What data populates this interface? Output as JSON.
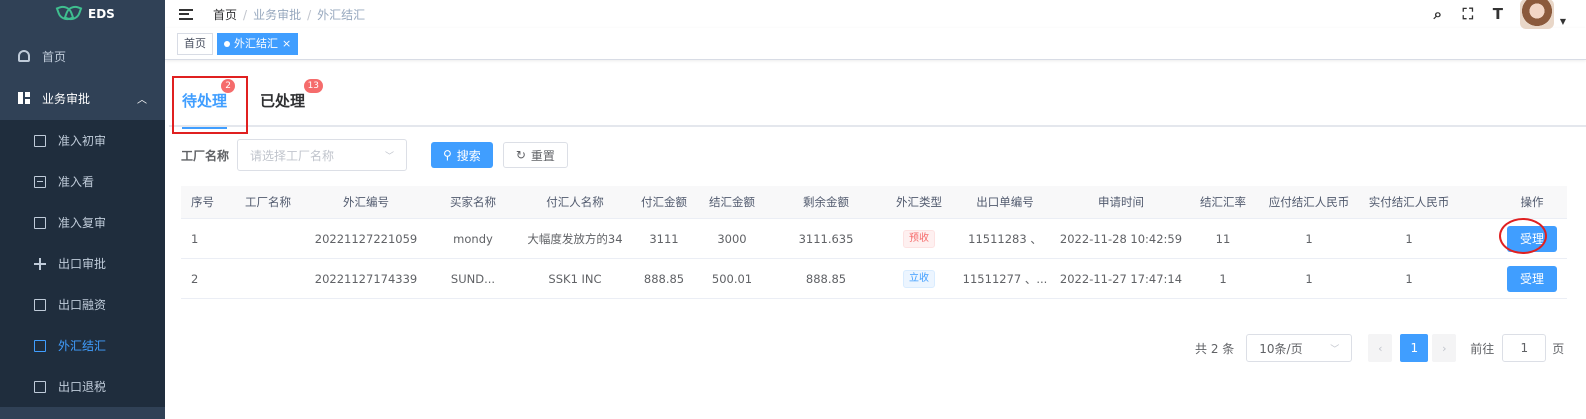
{
  "app": {
    "name": "EDS"
  },
  "sidebar": {
    "home": "首页",
    "group": "业务审批",
    "items": [
      {
        "label": "准入初审"
      },
      {
        "label": "准入看"
      },
      {
        "label": "准入复审"
      },
      {
        "label": "出口审批"
      },
      {
        "label": "出口融资"
      },
      {
        "label": "外汇结汇"
      },
      {
        "label": "出口退税"
      }
    ]
  },
  "breadcrumb": {
    "home": "首页",
    "sep": "/",
    "level1": "业务审批",
    "level2": "外汇结汇"
  },
  "tagsview": {
    "home": "首页",
    "current": "外汇结汇",
    "close": "×"
  },
  "tabs": [
    {
      "label": "待处理",
      "badge": "2"
    },
    {
      "label": "已处理",
      "badge": "13"
    }
  ],
  "filter": {
    "label": "工厂名称",
    "placeholder": "请选择工厂名称",
    "search": "搜索",
    "reset": "重置"
  },
  "table": {
    "headers": [
      "序号",
      "工厂名称",
      "外汇编号",
      "买家名称",
      "付汇人名称",
      "付汇金额",
      "结汇金额",
      "剩余金额",
      "外汇类型",
      "出口单编号",
      "申请时间",
      "结汇汇率",
      "应付结汇人民币",
      "实付结汇人民币",
      "操作"
    ],
    "rows": [
      {
        "idx": "1",
        "factory": "",
        "no": "20221127221059",
        "buyer": "mondy",
        "payer": "大幅度发放方的34",
        "pay": "3111",
        "settle": "3000",
        "remain": "3111.635",
        "type": "预收",
        "export_no": "11511283 、",
        "time": "2022-11-28 10:42:59",
        "rate": "11",
        "receivable": "1",
        "actual": "1",
        "op": "受理"
      },
      {
        "idx": "2",
        "factory": "",
        "no": "20221127174339",
        "buyer": "SUND...",
        "payer": "SSK1 INC",
        "pay": "888.85",
        "settle": "500.01",
        "remain": "888.85",
        "type": "立收",
        "export_no": "11511277 、...",
        "time": "2022-11-27 17:47:14",
        "rate": "1",
        "receivable": "1",
        "actual": "1",
        "op": "受理"
      }
    ]
  },
  "pagination": {
    "total": "共 2 条",
    "page_size": "10条/页",
    "prev": "‹",
    "page": "1",
    "next": "›",
    "jump_label": "前往",
    "jump_value": "1",
    "jump_unit": "页"
  },
  "colors": {
    "primary": "#409eff",
    "sidebar": "#304156",
    "danger": "#f56c6c",
    "annotation": "#e02020"
  }
}
